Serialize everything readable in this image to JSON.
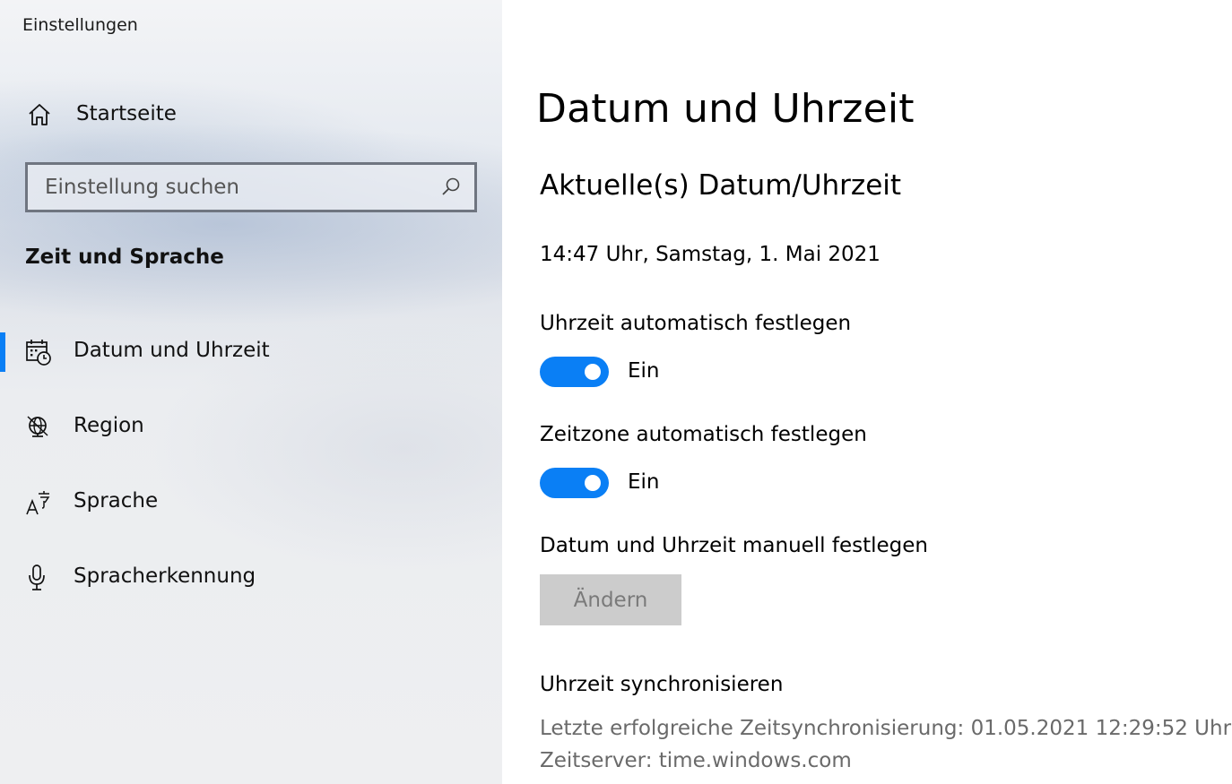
{
  "window": {
    "title": "Einstellungen"
  },
  "sidebar": {
    "home_label": "Startseite",
    "search": {
      "placeholder": "Einstellung suchen",
      "value": ""
    },
    "section_title": "Zeit und Sprache",
    "items": [
      {
        "label": "Datum und Uhrzeit",
        "icon": "calendar-clock-icon",
        "active": true
      },
      {
        "label": "Region",
        "icon": "globe-icon",
        "active": false
      },
      {
        "label": "Sprache",
        "icon": "language-icon",
        "active": false
      },
      {
        "label": "Spracherkennung",
        "icon": "microphone-icon",
        "active": false
      }
    ],
    "accent_color": "#0a7ff5"
  },
  "main": {
    "page_title": "Datum und Uhrzeit",
    "current_section_title": "Aktuelle(s) Datum/Uhrzeit",
    "current_datetime": "14:47 Uhr, Samstag, 1. Mai 2021",
    "auto_time": {
      "label": "Uhrzeit automatisch festlegen",
      "state": "Ein",
      "on": true
    },
    "auto_timezone": {
      "label": "Zeitzone automatisch festlegen",
      "state": "Ein",
      "on": true
    },
    "manual": {
      "label": "Datum und Uhrzeit manuell festlegen",
      "button_label": "Ändern"
    },
    "sync": {
      "title": "Uhrzeit synchronisieren",
      "last_sync": "Letzte erfolgreiche Zeitsynchronisierung: 01.05.2021 12:29:52 Uhr",
      "server": "Zeitserver: time.windows.com"
    }
  }
}
